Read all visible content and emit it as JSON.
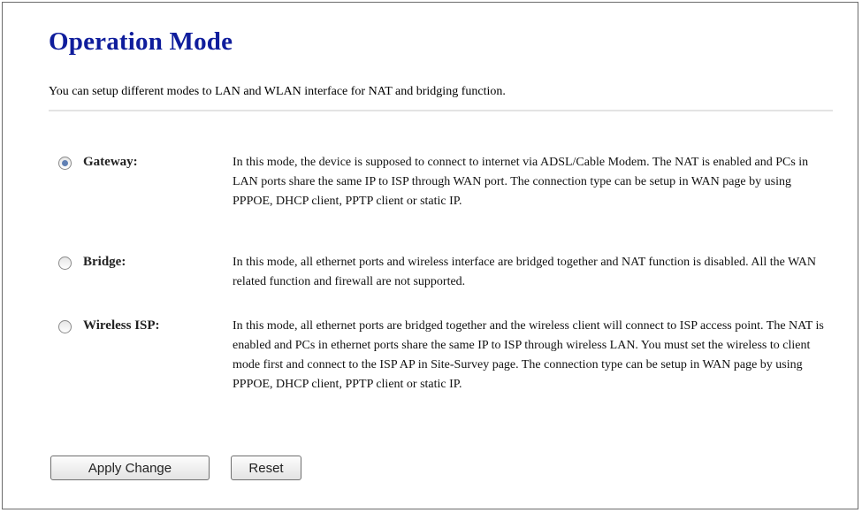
{
  "page": {
    "title": "Operation Mode",
    "intro": "You can setup different modes to LAN and WLAN interface for NAT and bridging function."
  },
  "options": [
    {
      "label": "Gateway:",
      "selected": true,
      "description": "In this mode, the device is supposed to connect to internet via ADSL/Cable Modem. The NAT is enabled and PCs in LAN ports share the same IP to ISP through WAN port. The connection type can be setup in WAN page by using PPPOE, DHCP client, PPTP client or static IP."
    },
    {
      "label": "Bridge:",
      "selected": false,
      "description": "In this mode, all ethernet ports and wireless interface are bridged together and NAT function is disabled. All the WAN related function and firewall are not supported."
    },
    {
      "label": "Wireless ISP:",
      "selected": false,
      "description": "In this mode, all ethernet ports are bridged together and the wireless client will connect to ISP access point. The NAT is enabled and PCs in ethernet ports share the same IP to ISP through wireless LAN. You must set the wireless to client mode first and connect to the ISP AP in Site-Survey page. The connection type can be setup in WAN page by using PPPOE, DHCP client, PPTP client or static IP."
    }
  ],
  "buttons": {
    "apply": "Apply Change",
    "reset": "Reset"
  },
  "colors": {
    "title": "#0f1d9c",
    "radio_dot": "#5f7fb3"
  }
}
